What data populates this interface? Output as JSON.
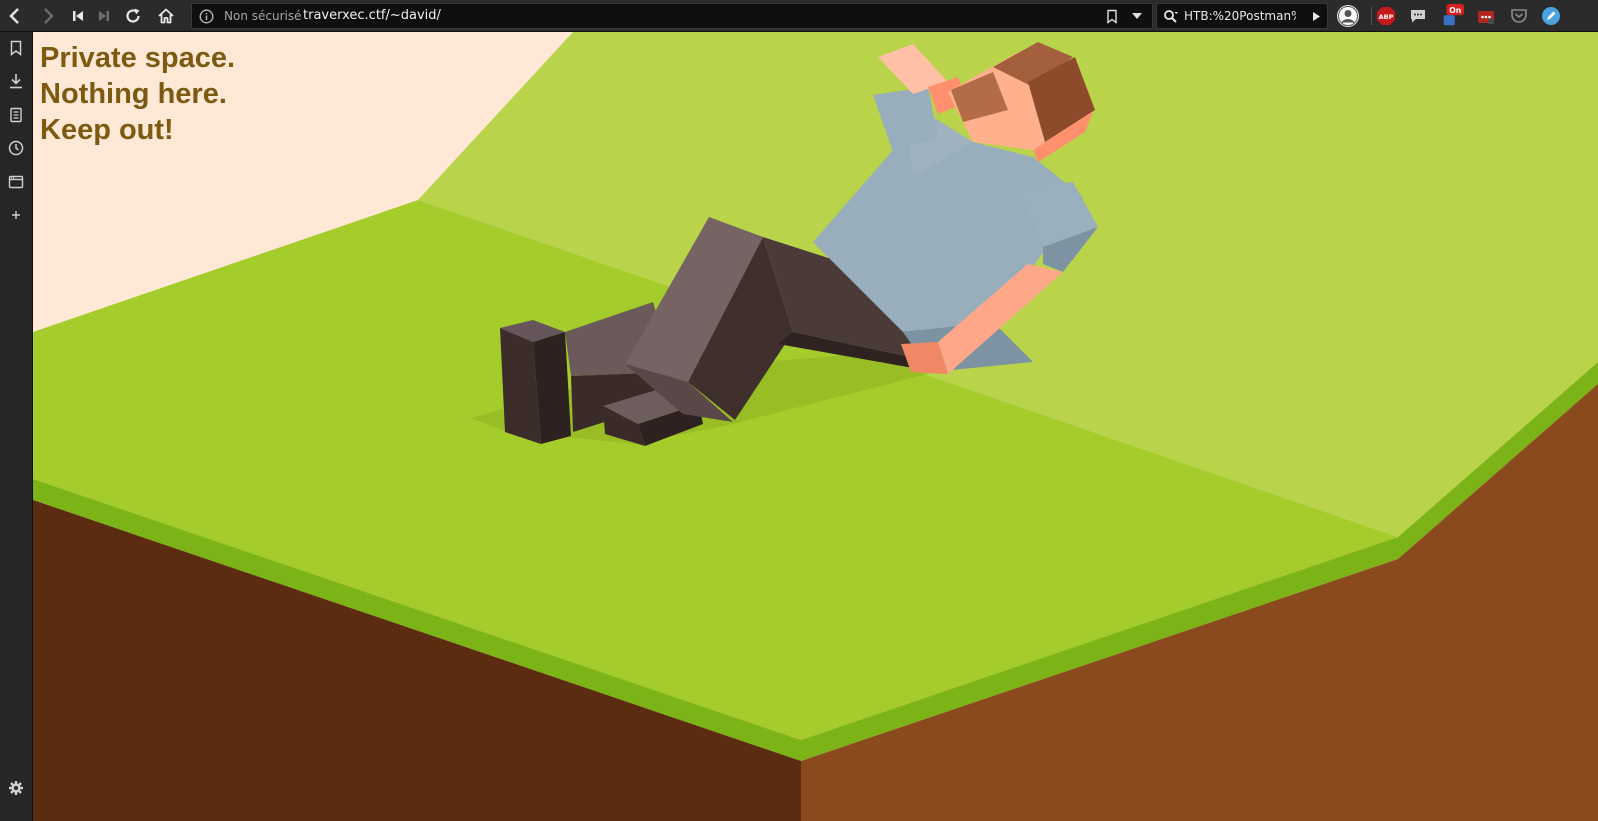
{
  "toolbar": {
    "insecure_label": "Non sécurisé",
    "url": "traverxec.ctf/~david/",
    "search_text": "HTB:%20Postman%",
    "extensions": {
      "abp_label": "ABP",
      "badge_label": "On"
    }
  },
  "page": {
    "message_lines": [
      "Private space.",
      "Nothing here.",
      "Keep out!"
    ]
  },
  "colors": {
    "message": "#7d5a12",
    "background": "#ffe8d6",
    "grass_light": "#b9d44a",
    "grass": "#a4cc2a",
    "grass_edge": "#7cb316",
    "soil_dark": "#5c2c10",
    "soil": "#8b4a1d"
  }
}
